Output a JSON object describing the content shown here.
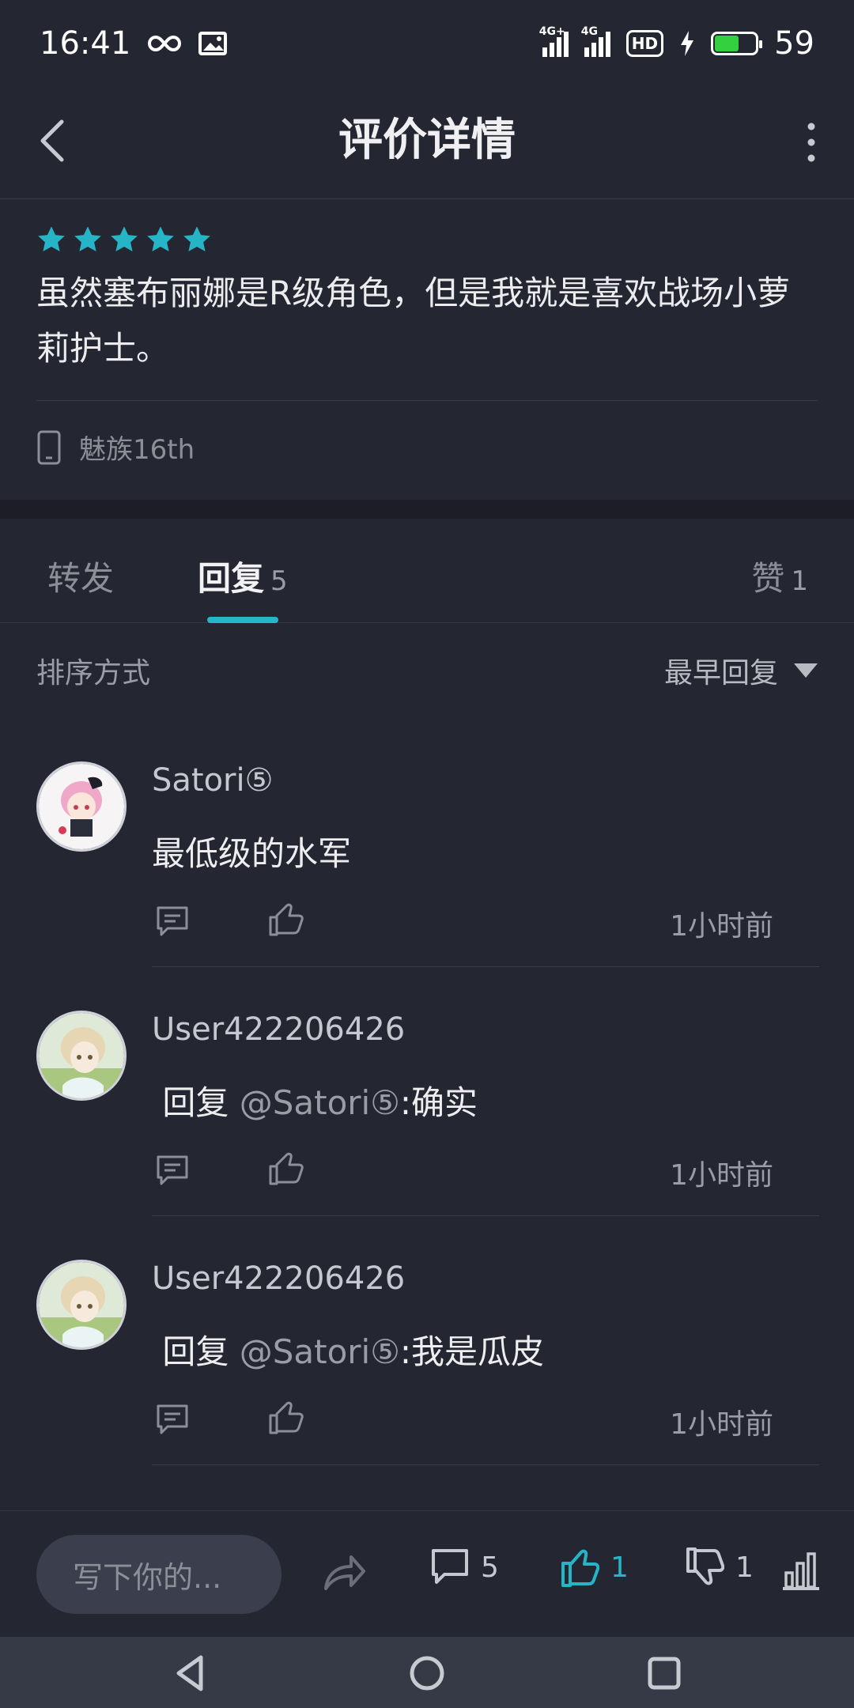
{
  "status_bar": {
    "time": "16:41",
    "network1": "4G+",
    "network2": "4G",
    "hd": "HD",
    "battery": "59",
    "icons": [
      "infinity-icon",
      "image-icon",
      "signal-icon",
      "hd-call-icon",
      "charging-icon",
      "battery-icon"
    ]
  },
  "header": {
    "title": "评价详情"
  },
  "review": {
    "rating": 5,
    "star_color": "#26b5c6",
    "text": "虽然塞布丽娜是R级角色，但是我就是喜欢战场小萝莉护士。",
    "device": "魅族16th"
  },
  "tabs": {
    "forward_label": "转发",
    "reply_label": "回复",
    "reply_count": "5",
    "like_label": "赞",
    "like_count": "1"
  },
  "sort": {
    "label": "排序方式",
    "value": "最早回复"
  },
  "replies": [
    {
      "name": "Satori⑤",
      "prefix": "",
      "mention": "",
      "text": "最低级的水军",
      "time": "1小时前"
    },
    {
      "name": "User422206426",
      "prefix": " 回复 ",
      "mention": "@Satori⑤",
      "text": ":确实",
      "time": "1小时前"
    },
    {
      "name": "User422206426",
      "prefix": " 回复 ",
      "mention": "@Satori⑤",
      "text": ":我是瓜皮",
      "time": "1小时前"
    }
  ],
  "bottom_bar": {
    "compose_placeholder": "写下你的...",
    "comment_count": "5",
    "like_count": "1",
    "dislike_count": "1",
    "accent_color": "#26b5c6"
  }
}
